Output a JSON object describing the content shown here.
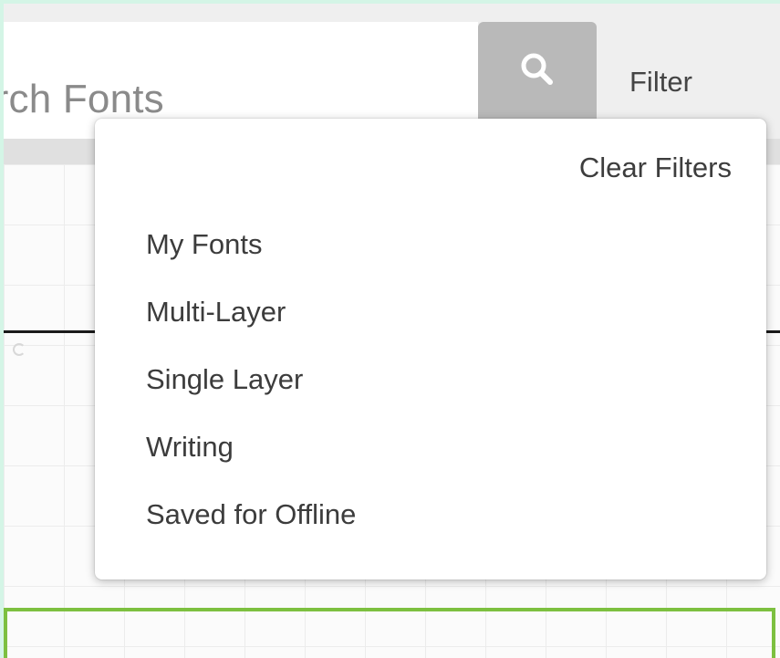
{
  "search": {
    "visible_text": "arch Fonts"
  },
  "toolbar": {
    "filter_label": "Filter"
  },
  "dropdown": {
    "clear_filters_label": "Clear Filters",
    "items": [
      {
        "label": "My Fonts"
      },
      {
        "label": "Multi-Layer"
      },
      {
        "label": "Single Layer"
      },
      {
        "label": "Writing"
      },
      {
        "label": "Saved for Offline"
      }
    ]
  },
  "icons": {
    "search_button": "search-icon"
  },
  "colors": {
    "search_button_bg": "#b9b9b9",
    "selection_frame": "#7dc040",
    "outer_border": "#d4f5e6"
  }
}
